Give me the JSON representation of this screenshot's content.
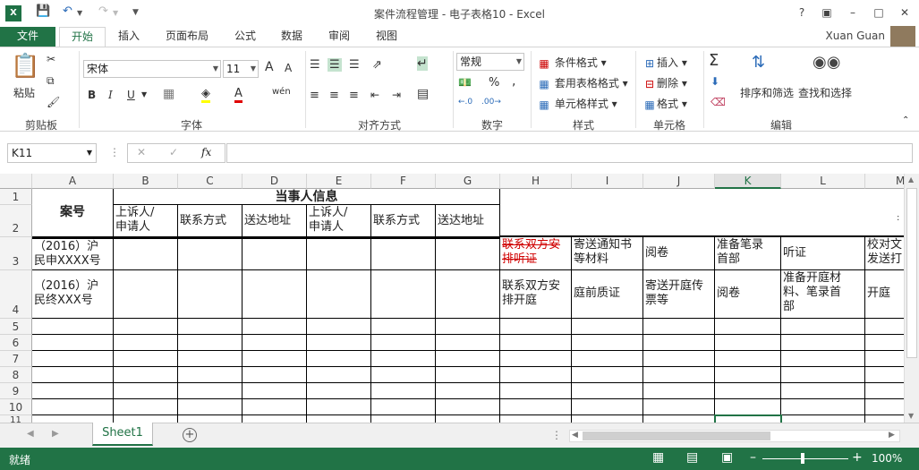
{
  "window": {
    "title": "案件流程管理 - 电子表格10 - Excel",
    "user": "Xuan Guan",
    "app_badge": "X"
  },
  "tabs": [
    "文件",
    "开始",
    "插入",
    "页面布局",
    "公式",
    "数据",
    "审阅",
    "视图"
  ],
  "ribbon": {
    "clipboard": {
      "paste": "粘贴",
      "label": "剪贴板"
    },
    "font": {
      "name": "宋体",
      "size": "11",
      "label": "字体",
      "bold": "B",
      "italic": "I",
      "underline": "U",
      "phonetic": "wén",
      "grow": "A",
      "shrink": "A"
    },
    "alignment": {
      "label": "对齐方式"
    },
    "number": {
      "format": "常规",
      "label": "数字",
      "percent": "%",
      "comma": ","
    },
    "styles": {
      "conditional": "条件格式",
      "table": "套用表格格式",
      "cell": "单元格样式",
      "label": "样式"
    },
    "cells": {
      "insert": "插入",
      "delete": "删除",
      "format": "格式",
      "label": "单元格"
    },
    "editing": {
      "sort": "排序和筛选",
      "find": "查找和选择",
      "label": "编辑"
    }
  },
  "formula_bar": {
    "name_box": "K11",
    "fx": "fx",
    "value": ""
  },
  "sheet": {
    "columns": [
      "A",
      "B",
      "C",
      "D",
      "E",
      "F",
      "G",
      "H",
      "I",
      "J",
      "K",
      "L",
      "M"
    ],
    "rows": [
      "1",
      "2",
      "3",
      "4",
      "5",
      "6",
      "7",
      "8",
      "9",
      "10",
      "11"
    ],
    "cells": {
      "A1": "案号",
      "B1": "当事人信息",
      "B2": "上诉人/\n申请人",
      "C2": "联系方式",
      "D2": "送达地址",
      "E2": "上诉人/\n申请人",
      "F2": "联系方式",
      "G2": "送达地址",
      "A3": "（2016）沪\n民申XXXX号",
      "H3": "联系双方安\n排听证",
      "I3": "寄送通知书\n等材料",
      "J3": "阅卷",
      "K3": "准备笔录\n首部",
      "L3": "听证",
      "M3": "校对文\n发送打",
      "A4": "（2016）沪\n民终XXX号",
      "H4": "联系双方安\n排开庭",
      "I4": "庭前质证",
      "J4": "寄送开庭传\n票等",
      "K4": "阅卷",
      "L4": "准备开庭材\n料、笔录首\n部",
      "M4": "开庭"
    },
    "strike_color": "#d00000"
  },
  "sheet_tabs": [
    "Sheet1"
  ],
  "status": {
    "ready": "就绪",
    "zoom": "100%"
  }
}
